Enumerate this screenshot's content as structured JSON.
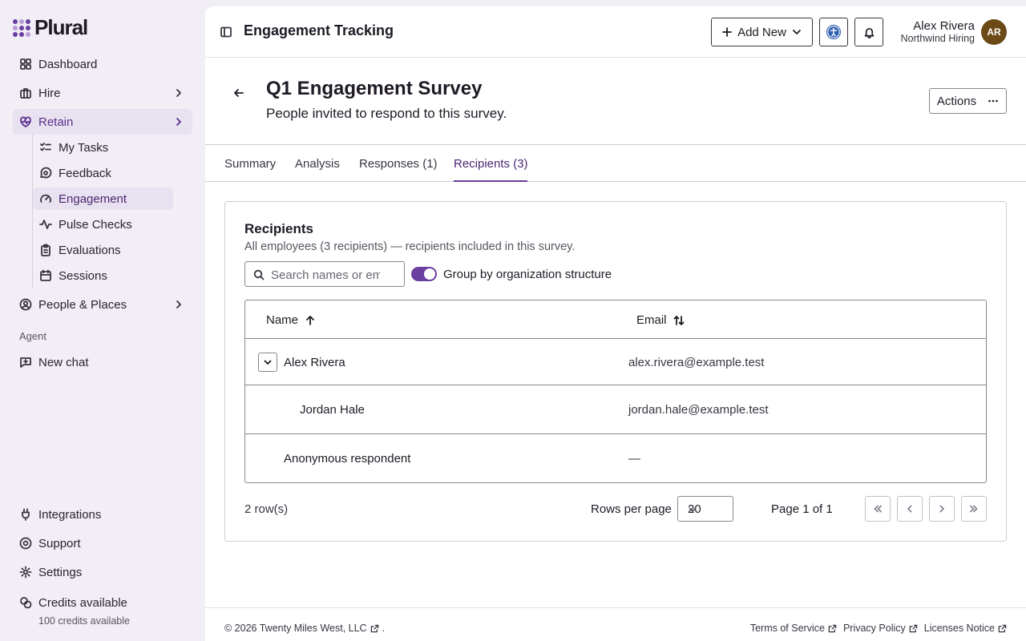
{
  "app": {
    "name": "Plural"
  },
  "sidebar": {
    "items": [
      {
        "label": "Dashboard",
        "icon": "grid-icon"
      },
      {
        "label": "Hire",
        "icon": "briefcase-icon"
      },
      {
        "label": "Retain",
        "icon": "heart-pulse-icon"
      },
      {
        "label": "People & Places",
        "icon": "user-circle-icon"
      }
    ],
    "retain_sub": [
      {
        "label": "My Tasks",
        "icon": "checklist-icon"
      },
      {
        "label": "Feedback",
        "icon": "message-icon"
      },
      {
        "label": "Engagement",
        "icon": "gauge-icon"
      },
      {
        "label": "Pulse Checks",
        "icon": "activity-icon"
      },
      {
        "label": "Evaluations",
        "icon": "clipboard-icon"
      },
      {
        "label": "Sessions",
        "icon": "calendar-icon"
      }
    ],
    "agent_label": "Agent",
    "new_chat": "New chat",
    "bottom": [
      {
        "label": "Integrations",
        "icon": "plug-icon"
      },
      {
        "label": "Support",
        "icon": "life-buoy-icon"
      },
      {
        "label": "Settings",
        "icon": "gear-icon"
      },
      {
        "label": "Credits available",
        "icon": "coins-icon"
      }
    ],
    "credits_sub": "100 credits available"
  },
  "topbar": {
    "title": "Engagement Tracking",
    "add_new": "Add New",
    "user_name": "Alex Rivera",
    "user_org": "Northwind Hiring",
    "avatar_initials": "AR",
    "avatar_color": "#6b4a16"
  },
  "page": {
    "title": "Q1 Engagement Survey",
    "subtitle": "People invited to respond to this survey.",
    "actions_label": "Actions"
  },
  "tabs": [
    "Summary",
    "Analysis",
    "Responses (1)",
    "Recipients (3)"
  ],
  "active_tab": "Recipients (3)",
  "recipients": {
    "title": "Recipients",
    "description": "All employees (3 recipients) — recipients included in this survey.",
    "search_placeholder": "Search names or emails",
    "group_toggle_label": "Group by organization structure",
    "group_toggle_on": true,
    "columns": {
      "name": "Name",
      "email": "Email"
    },
    "rows": [
      {
        "name": "Alex Rivera",
        "email": "alex.rivera@example.test"
      },
      {
        "name": "Jordan Hale",
        "email": "jordan.hale@example.test"
      },
      {
        "name": "Anonymous respondent",
        "email": "—"
      }
    ],
    "row_count": "2 row(s)",
    "rows_per_page_label": "Rows per page",
    "rows_per_page": "20",
    "page_label": "Page 1 of 1"
  },
  "footer": {
    "copyright": "© 2026 Twenty Miles West, LLC",
    "copyright_suffix": ".",
    "links": [
      "Terms of Service",
      "Privacy Policy",
      "Licenses Notice"
    ]
  },
  "colors": {
    "accent": "#6b3fa0",
    "sidebar_bg": "#f1eef6",
    "active_bg": "#e8e1f0"
  }
}
